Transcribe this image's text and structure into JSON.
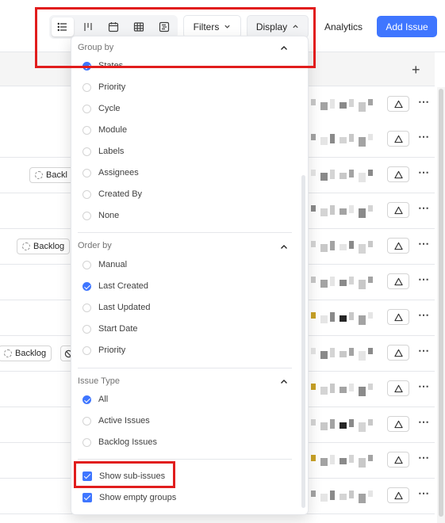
{
  "header": {
    "layouts": [
      {
        "icon": "list-layout-icon",
        "active": true
      },
      {
        "icon": "kanban-layout-icon",
        "active": false
      },
      {
        "icon": "calendar-layout-icon",
        "active": false
      },
      {
        "icon": "spreadsheet-layout-icon",
        "active": false
      },
      {
        "icon": "gantt-layout-icon",
        "active": false
      }
    ],
    "filters_label": "Filters",
    "display_label": "Display",
    "analytics_label": "Analytics",
    "add_issue_label": "Add Issue"
  },
  "rows": {
    "backlog_label": "Backlog",
    "backlog_truncated": "Backl"
  },
  "display_menu": {
    "group_by": {
      "title": "Group by",
      "options": [
        {
          "label": "States",
          "checked": true
        },
        {
          "label": "Priority",
          "checked": false
        },
        {
          "label": "Cycle",
          "checked": false
        },
        {
          "label": "Module",
          "checked": false
        },
        {
          "label": "Labels",
          "checked": false
        },
        {
          "label": "Assignees",
          "checked": false
        },
        {
          "label": "Created By",
          "checked": false
        },
        {
          "label": "None",
          "checked": false
        }
      ]
    },
    "order_by": {
      "title": "Order by",
      "options": [
        {
          "label": "Manual",
          "checked": false
        },
        {
          "label": "Last Created",
          "checked": true
        },
        {
          "label": "Last Updated",
          "checked": false
        },
        {
          "label": "Start Date",
          "checked": false
        },
        {
          "label": "Priority",
          "checked": false
        }
      ]
    },
    "issue_type": {
      "title": "Issue Type",
      "options": [
        {
          "label": "All",
          "checked": true
        },
        {
          "label": "Active Issues",
          "checked": false
        },
        {
          "label": "Backlog Issues",
          "checked": false
        }
      ]
    },
    "toggles": {
      "show_sub_issues": "Show sub-issues",
      "show_empty_groups": "Show empty groups"
    }
  },
  "colors": {
    "accent": "#3f76ff",
    "highlight": "#e11d1d"
  }
}
